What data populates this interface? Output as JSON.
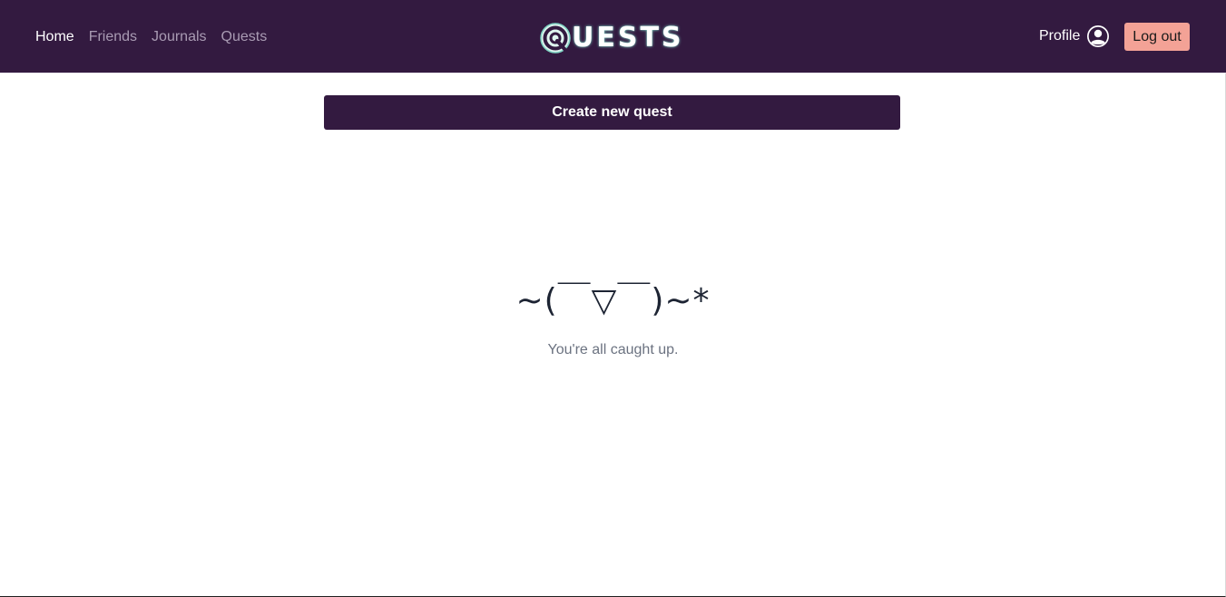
{
  "nav": {
    "links": [
      {
        "label": "Home",
        "active": true
      },
      {
        "label": "Friends",
        "active": false
      },
      {
        "label": "Journals",
        "active": false
      },
      {
        "label": "Quests",
        "active": false
      }
    ],
    "logo_text": "UESTS",
    "profile_label": "Profile",
    "logout_label": "Log out"
  },
  "main": {
    "create_label": "Create new quest",
    "empty_kaomoji": "~(￣▽￣)~*",
    "empty_message": "You're all caught up."
  },
  "colors": {
    "brand": "#331a40",
    "logout_bg": "#f3a296",
    "logo_glow": "#7fd3c4"
  },
  "icons": {
    "logo": "quests-q-logo-icon",
    "avatar": "user-circle-icon"
  }
}
